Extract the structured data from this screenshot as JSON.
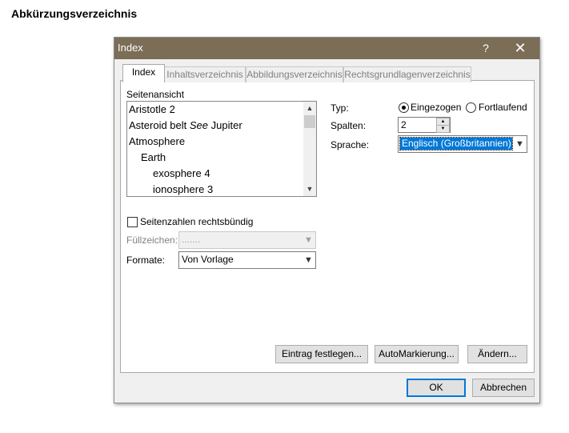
{
  "document": {
    "heading": "Abkürzungsverzeichnis"
  },
  "dialog": {
    "title": "Index",
    "help_label": "?",
    "close_label": "✕",
    "tabs": [
      {
        "label": "Index"
      },
      {
        "label": "Inhaltsverzeichnis"
      },
      {
        "label": "Abbildungsverzeichnis"
      },
      {
        "label": "Rechtsgrundlagenverzeichnis"
      }
    ],
    "preview": {
      "label": "Seitenansicht",
      "items": [
        {
          "text": "Aristotle  2"
        },
        {
          "prefix": "Asteroid belt  ",
          "see": "See",
          "suffix": " Jupiter"
        },
        {
          "text": "Atmosphere"
        },
        {
          "text": "Earth"
        },
        {
          "text": "exosphere  4"
        },
        {
          "text": "ionosphere  3"
        }
      ]
    },
    "right_align": {
      "label": "Seitenzahlen rechtsbündig",
      "checked": false
    },
    "tab_leader": {
      "label": "Füllzeichen:",
      "value": "......."
    },
    "formats": {
      "label": "Formate:",
      "value": "Von Vorlage"
    },
    "type": {
      "label": "Typ:",
      "option_indented": "Eingezogen",
      "option_runin": "Fortlaufend",
      "selected": "Eingezogen"
    },
    "columns": {
      "label": "Spalten:",
      "value": "2"
    },
    "language": {
      "label": "Sprache:",
      "value": "Englisch (Großbritannien)"
    },
    "buttons": {
      "mark_entry": "Eintrag festlegen...",
      "automark": "AutoMarkierung...",
      "modify": "Ändern...",
      "ok": "OK",
      "cancel": "Abbrechen"
    }
  }
}
